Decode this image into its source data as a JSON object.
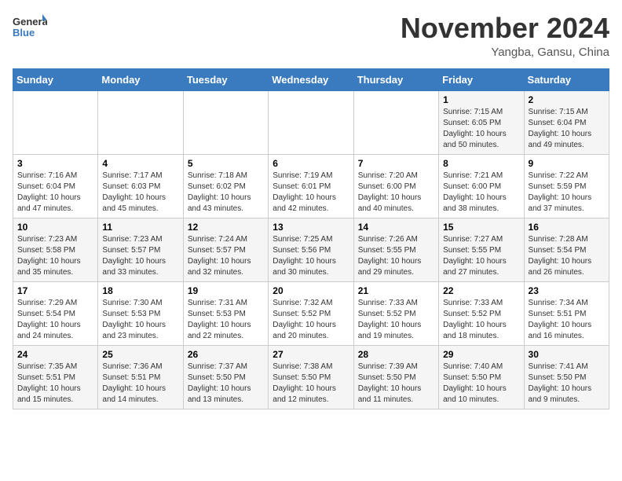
{
  "header": {
    "logo_general": "General",
    "logo_blue": "Blue",
    "month_title": "November 2024",
    "location": "Yangba, Gansu, China"
  },
  "days_of_week": [
    "Sunday",
    "Monday",
    "Tuesday",
    "Wednesday",
    "Thursday",
    "Friday",
    "Saturday"
  ],
  "weeks": [
    [
      {
        "day": "",
        "info": ""
      },
      {
        "day": "",
        "info": ""
      },
      {
        "day": "",
        "info": ""
      },
      {
        "day": "",
        "info": ""
      },
      {
        "day": "",
        "info": ""
      },
      {
        "day": "1",
        "info": "Sunrise: 7:15 AM\nSunset: 6:05 PM\nDaylight: 10 hours\nand 50 minutes."
      },
      {
        "day": "2",
        "info": "Sunrise: 7:15 AM\nSunset: 6:04 PM\nDaylight: 10 hours\nand 49 minutes."
      }
    ],
    [
      {
        "day": "3",
        "info": "Sunrise: 7:16 AM\nSunset: 6:04 PM\nDaylight: 10 hours\nand 47 minutes."
      },
      {
        "day": "4",
        "info": "Sunrise: 7:17 AM\nSunset: 6:03 PM\nDaylight: 10 hours\nand 45 minutes."
      },
      {
        "day": "5",
        "info": "Sunrise: 7:18 AM\nSunset: 6:02 PM\nDaylight: 10 hours\nand 43 minutes."
      },
      {
        "day": "6",
        "info": "Sunrise: 7:19 AM\nSunset: 6:01 PM\nDaylight: 10 hours\nand 42 minutes."
      },
      {
        "day": "7",
        "info": "Sunrise: 7:20 AM\nSunset: 6:00 PM\nDaylight: 10 hours\nand 40 minutes."
      },
      {
        "day": "8",
        "info": "Sunrise: 7:21 AM\nSunset: 6:00 PM\nDaylight: 10 hours\nand 38 minutes."
      },
      {
        "day": "9",
        "info": "Sunrise: 7:22 AM\nSunset: 5:59 PM\nDaylight: 10 hours\nand 37 minutes."
      }
    ],
    [
      {
        "day": "10",
        "info": "Sunrise: 7:23 AM\nSunset: 5:58 PM\nDaylight: 10 hours\nand 35 minutes."
      },
      {
        "day": "11",
        "info": "Sunrise: 7:23 AM\nSunset: 5:57 PM\nDaylight: 10 hours\nand 33 minutes."
      },
      {
        "day": "12",
        "info": "Sunrise: 7:24 AM\nSunset: 5:57 PM\nDaylight: 10 hours\nand 32 minutes."
      },
      {
        "day": "13",
        "info": "Sunrise: 7:25 AM\nSunset: 5:56 PM\nDaylight: 10 hours\nand 30 minutes."
      },
      {
        "day": "14",
        "info": "Sunrise: 7:26 AM\nSunset: 5:55 PM\nDaylight: 10 hours\nand 29 minutes."
      },
      {
        "day": "15",
        "info": "Sunrise: 7:27 AM\nSunset: 5:55 PM\nDaylight: 10 hours\nand 27 minutes."
      },
      {
        "day": "16",
        "info": "Sunrise: 7:28 AM\nSunset: 5:54 PM\nDaylight: 10 hours\nand 26 minutes."
      }
    ],
    [
      {
        "day": "17",
        "info": "Sunrise: 7:29 AM\nSunset: 5:54 PM\nDaylight: 10 hours\nand 24 minutes."
      },
      {
        "day": "18",
        "info": "Sunrise: 7:30 AM\nSunset: 5:53 PM\nDaylight: 10 hours\nand 23 minutes."
      },
      {
        "day": "19",
        "info": "Sunrise: 7:31 AM\nSunset: 5:53 PM\nDaylight: 10 hours\nand 22 minutes."
      },
      {
        "day": "20",
        "info": "Sunrise: 7:32 AM\nSunset: 5:52 PM\nDaylight: 10 hours\nand 20 minutes."
      },
      {
        "day": "21",
        "info": "Sunrise: 7:33 AM\nSunset: 5:52 PM\nDaylight: 10 hours\nand 19 minutes."
      },
      {
        "day": "22",
        "info": "Sunrise: 7:33 AM\nSunset: 5:52 PM\nDaylight: 10 hours\nand 18 minutes."
      },
      {
        "day": "23",
        "info": "Sunrise: 7:34 AM\nSunset: 5:51 PM\nDaylight: 10 hours\nand 16 minutes."
      }
    ],
    [
      {
        "day": "24",
        "info": "Sunrise: 7:35 AM\nSunset: 5:51 PM\nDaylight: 10 hours\nand 15 minutes."
      },
      {
        "day": "25",
        "info": "Sunrise: 7:36 AM\nSunset: 5:51 PM\nDaylight: 10 hours\nand 14 minutes."
      },
      {
        "day": "26",
        "info": "Sunrise: 7:37 AM\nSunset: 5:50 PM\nDaylight: 10 hours\nand 13 minutes."
      },
      {
        "day": "27",
        "info": "Sunrise: 7:38 AM\nSunset: 5:50 PM\nDaylight: 10 hours\nand 12 minutes."
      },
      {
        "day": "28",
        "info": "Sunrise: 7:39 AM\nSunset: 5:50 PM\nDaylight: 10 hours\nand 11 minutes."
      },
      {
        "day": "29",
        "info": "Sunrise: 7:40 AM\nSunset: 5:50 PM\nDaylight: 10 hours\nand 10 minutes."
      },
      {
        "day": "30",
        "info": "Sunrise: 7:41 AM\nSunset: 5:50 PM\nDaylight: 10 hours\nand 9 minutes."
      }
    ]
  ]
}
